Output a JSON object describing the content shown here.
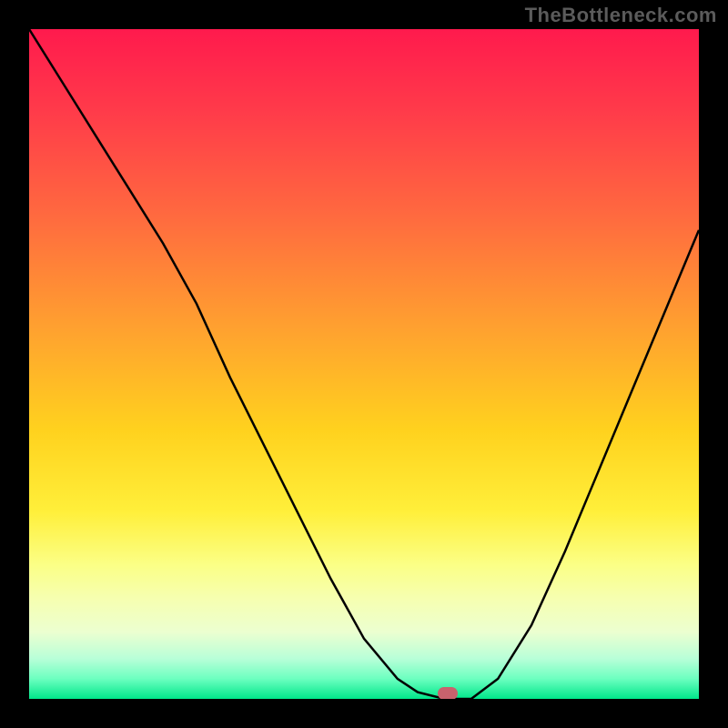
{
  "watermark": "TheBottleneck.com",
  "marker": {
    "x_pct": 62.5,
    "y_pct": 99.2
  },
  "chart_data": {
    "type": "line",
    "title": "",
    "xlabel": "",
    "ylabel": "",
    "xlim": [
      0,
      100
    ],
    "ylim": [
      0,
      100
    ],
    "x": [
      0,
      5,
      10,
      15,
      20,
      25,
      30,
      35,
      40,
      45,
      50,
      55,
      58,
      62,
      66,
      70,
      75,
      80,
      85,
      90,
      95,
      100
    ],
    "values": [
      100,
      92,
      84,
      76,
      68,
      59,
      48,
      38,
      28,
      18,
      9,
      3,
      1,
      0,
      0,
      3,
      11,
      22,
      34,
      46,
      58,
      70
    ],
    "background_gradient": {
      "direction": "vertical",
      "stops": [
        {
          "pct": 0,
          "color": "#ff1a4d"
        },
        {
          "pct": 45,
          "color": "#ffa22f"
        },
        {
          "pct": 72,
          "color": "#ffef3a"
        },
        {
          "pct": 90,
          "color": "#ecffd0"
        },
        {
          "pct": 100,
          "color": "#00e78a"
        }
      ]
    },
    "marker_point": {
      "x": 62.5,
      "y": 0
    }
  }
}
